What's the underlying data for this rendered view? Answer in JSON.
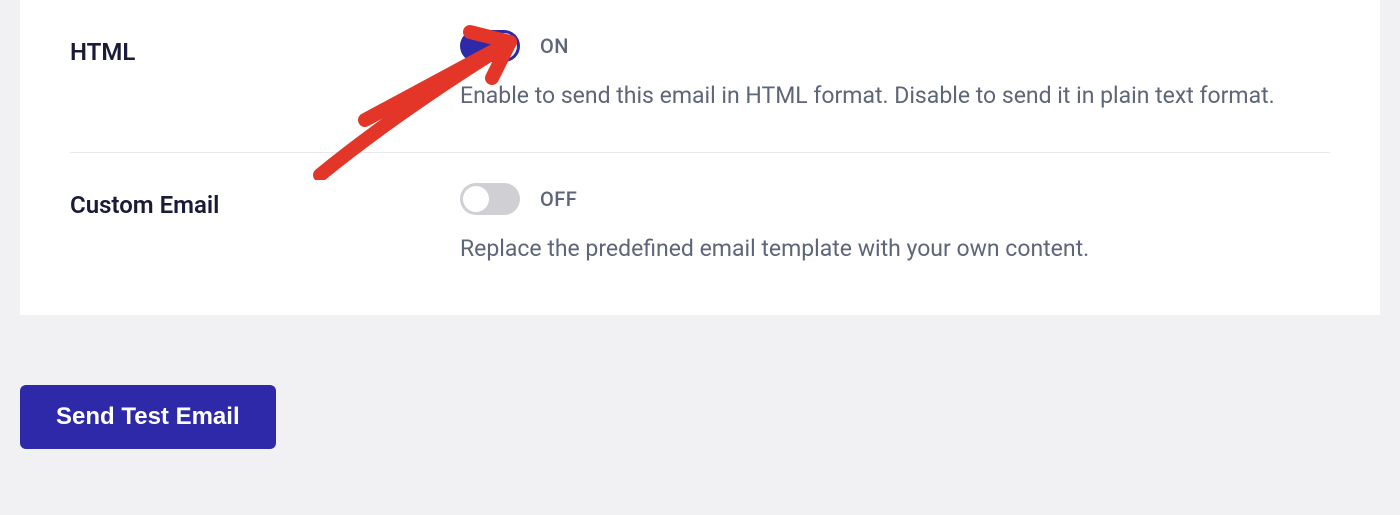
{
  "settings": {
    "html": {
      "label": "HTML",
      "state": "ON",
      "isOn": true,
      "description": "Enable to send this email in HTML format. Disable to send it in plain text format."
    },
    "customEmail": {
      "label": "Custom Email",
      "state": "OFF",
      "isOn": false,
      "description": "Replace the predefined email template with your own content."
    }
  },
  "footer": {
    "sendButton": "Send Test Email"
  },
  "colors": {
    "primary": "#2e29a8",
    "mutedText": "#5d6578",
    "darkText": "#1a1a3a",
    "annotationRed": "#e33628"
  }
}
